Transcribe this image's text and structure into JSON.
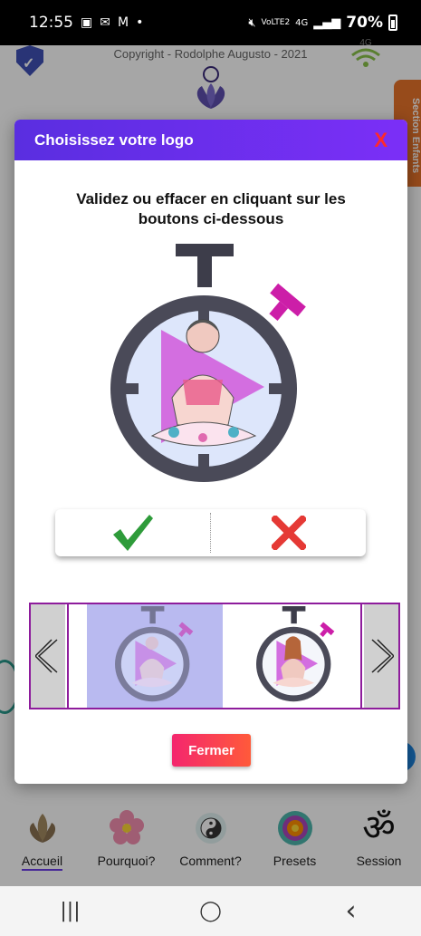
{
  "status_bar": {
    "time": "12:55",
    "network": "4G",
    "volte": "VoLTE2",
    "battery": "70%"
  },
  "background": {
    "copyright": "Copyright - Rodolphe Augusto - 2021",
    "wifi_label": "4G",
    "side_tab": "Section Enfants"
  },
  "modal": {
    "title": "Choisissez votre logo",
    "close": "X",
    "instruction": "Validez ou effacer en cliquant sur les boutons ci-dessous",
    "close_button": "Fermer"
  },
  "colors": {
    "header": "#6a2ff0",
    "accept": "#2e9b3a",
    "reject": "#e53935",
    "carousel_border": "#8e1c9c",
    "accent_magenta": "#cc1ea8"
  },
  "bottom_nav": {
    "items": [
      {
        "label": "Accueil",
        "icon": "lotus-icon"
      },
      {
        "label": "Pourquoi?",
        "icon": "flower-icon"
      },
      {
        "label": "Comment?",
        "icon": "yin-yang-icon"
      },
      {
        "label": "Presets",
        "icon": "mandala-icon"
      },
      {
        "label": "Session",
        "icon": "om-icon"
      }
    ],
    "om_glyph": "ॐ"
  },
  "system_nav": {
    "recents": "|||",
    "home": "◯",
    "back": "‹"
  }
}
